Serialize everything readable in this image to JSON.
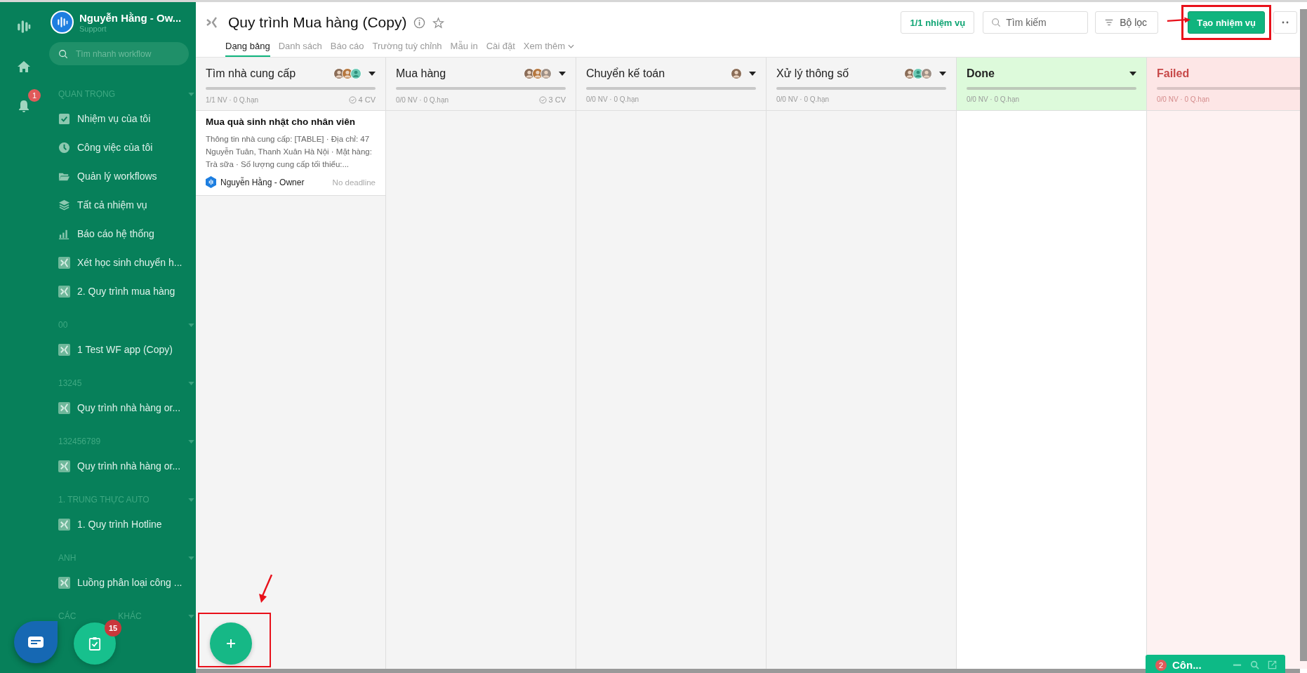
{
  "rail": {
    "notification_badge": "1"
  },
  "account": {
    "name": "Nguyễn Hằng - Ow...",
    "role": "Support"
  },
  "sidebar_search": {
    "placeholder": "Tìm nhanh workflow"
  },
  "sidebar_sections": [
    {
      "label": "QUAN TRỌNG",
      "items": [
        {
          "label": "Nhiệm vụ của tôi",
          "kind": "check"
        },
        {
          "label": "Công việc của tôi",
          "kind": "clock"
        },
        {
          "label": "Quản lý workflows",
          "kind": "folder"
        },
        {
          "label": "Tất cả nhiệm vụ",
          "kind": "layers"
        },
        {
          "label": "Báo cáo hệ thống",
          "kind": "chart"
        },
        {
          "label": "Xét học sinh chuyển h...",
          "kind": "workflow"
        },
        {
          "label": "2. Quy trình mua hàng",
          "kind": "workflow"
        }
      ]
    },
    {
      "label": "00",
      "items": [
        {
          "label": "1 Test WF app (Copy)",
          "kind": "workflow"
        }
      ]
    },
    {
      "label": "13245",
      "items": [
        {
          "label": "Quy trình nhà hàng or...",
          "kind": "workflow"
        }
      ]
    },
    {
      "label": "132456789",
      "items": [
        {
          "label": "Quy trình nhà hàng or...",
          "kind": "workflow"
        }
      ]
    },
    {
      "label": "1. TRUNG THỰC AUTO",
      "items": [
        {
          "label": "1. Quy trình Hotline",
          "kind": "workflow"
        }
      ]
    },
    {
      "label": "ANH",
      "items": [
        {
          "label": "Luồng phân loại công ...",
          "kind": "workflow"
        }
      ]
    },
    {
      "label_start": "CÁC",
      "label_end": "KHÁC"
    }
  ],
  "page": {
    "title": "Quy trình Mua hàng (Copy)",
    "tabs": [
      {
        "label": "Dạng bảng",
        "selected": true
      },
      {
        "label": "Danh sách",
        "selected": false
      },
      {
        "label": "Báo cáo",
        "selected": false
      },
      {
        "label": "Trường tuỳ chỉnh",
        "selected": false
      },
      {
        "label": "Mẫu in",
        "selected": false
      },
      {
        "label": "Cài đặt",
        "selected": false
      },
      {
        "label": "Xem thêm",
        "selected": false,
        "kind": "more"
      }
    ],
    "task_count": "1/1 nhiệm vụ",
    "search": {
      "placeholder": "Tìm kiếm"
    },
    "filter": "Bộ lọc",
    "create": "Tạo nhiệm vụ"
  },
  "columns": [
    {
      "title": "Tìm nhà cung cấp",
      "kind": "stage",
      "avatars": [
        {
          "kind": "photo"
        },
        {
          "kind": "photo"
        },
        {
          "kind": "user"
        }
      ],
      "level": 0,
      "stats": "1/1 NV · 0 Q.hạn",
      "count": "4 CV",
      "cards": [
        {
          "title": "Mua quà sinh nhật cho nhân viên",
          "description": "Thông tin nhà cung cấp: [TABLE] · Địa chỉ: 47 Nguyễn Tuân, Thanh Xuân Hà Nội · Mặt hàng: Trà sữa · Số lượng cung cấp tối thiểu:...",
          "assignee": "Nguyễn Hằng - Owner",
          "deadline": "No deadline"
        }
      ]
    },
    {
      "title": "Mua hàng",
      "kind": "stage",
      "avatars": [
        {
          "kind": "photo"
        },
        {
          "kind": "photo"
        },
        {
          "kind": "photo"
        }
      ],
      "level": 0,
      "stats": "0/0 NV · 0 Q.hạn",
      "count": "3 CV"
    },
    {
      "title": "Chuyển kế toán",
      "kind": "stage",
      "avatars": [
        {
          "kind": "photo"
        }
      ],
      "level": 0,
      "stats": "0/0 NV · 0 Q.hạn"
    },
    {
      "title": "Xử lý thông số",
      "kind": "stage",
      "avatars": [
        {
          "kind": "photo"
        },
        {
          "kind": "user"
        },
        {
          "kind": "photo"
        }
      ],
      "level": 0,
      "stats": "0/0 NV · 0 Q.hạn"
    },
    {
      "title": "Done",
      "kind": "done",
      "level": 0,
      "stats": "0/0 NV · 0 Q.hạn"
    },
    {
      "title": "Failed",
      "kind": "failed",
      "level": 0,
      "stats": "0/0 NV · 0 Q.hạn"
    }
  ],
  "task_badge": "15",
  "chat_widget": {
    "badge": "2",
    "title": "Côn..."
  }
}
